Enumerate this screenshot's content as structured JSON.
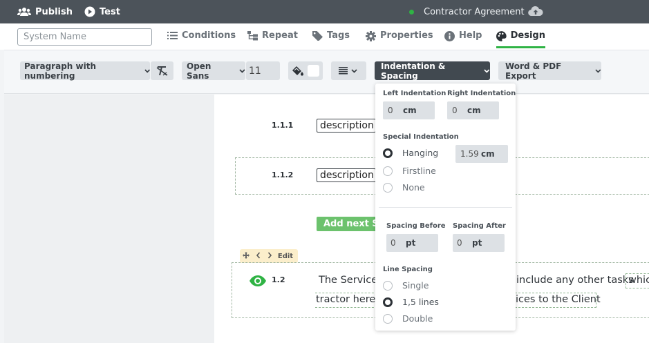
{
  "topbar": {
    "publish_label": "Publish",
    "test_label": "Test",
    "document_title": "Contractor Agreement"
  },
  "tabs": {
    "system_name_placeholder": "System Name",
    "items": [
      "Conditions",
      "Repeat",
      "Tags",
      "Properties",
      "Help",
      "Design"
    ],
    "active": "Design"
  },
  "toolbar": {
    "style_select": "Paragraph with numbering",
    "font_select": "Open Sans",
    "font_size": "11",
    "indentation_label": "Indentation & Spacing",
    "export_label": "Word & PDF Export"
  },
  "indent_panel": {
    "left_indentation_label": "Left Indentation",
    "left_value": "0",
    "left_unit": "cm",
    "right_indentation_label": "Right Indentation",
    "right_value": "0",
    "right_unit": "cm",
    "special_indentation_label": "Special Indentation",
    "special_options": [
      "Hanging",
      "Firstline",
      "None"
    ],
    "special_selected": "Hanging",
    "special_value": "1.59",
    "special_unit": "cm",
    "spacing_before_label": "Spacing Before",
    "spacing_before_value": "0",
    "spacing_before_unit": "pt",
    "spacing_after_label": "Spacing After",
    "spacing_after_value": "0",
    "spacing_after_unit": "pt",
    "line_spacing_label": "Line Spacing",
    "line_options": [
      "Single",
      "1,5 lines",
      "Double"
    ],
    "line_selected": "1,5 lines"
  },
  "document": {
    "item_1_num": "1.1.1",
    "item_1_text": "description",
    "item_2_num": "1.1.2",
    "item_2_text": "description",
    "add_next_label": "Add next S",
    "edit_label": "Edit",
    "clause_num": "1.2",
    "clause_line1_a": "The Services",
    "clause_line1_b": "include any other tasks",
    "clause_line1_c": "whic",
    "clause_line2_a": "tractor hereb",
    "clause_line2_b": "ices to the Client"
  },
  "colors": {
    "accent_green": "#2fb344",
    "topbar": "#4c535a",
    "dark_button": "#414950"
  }
}
